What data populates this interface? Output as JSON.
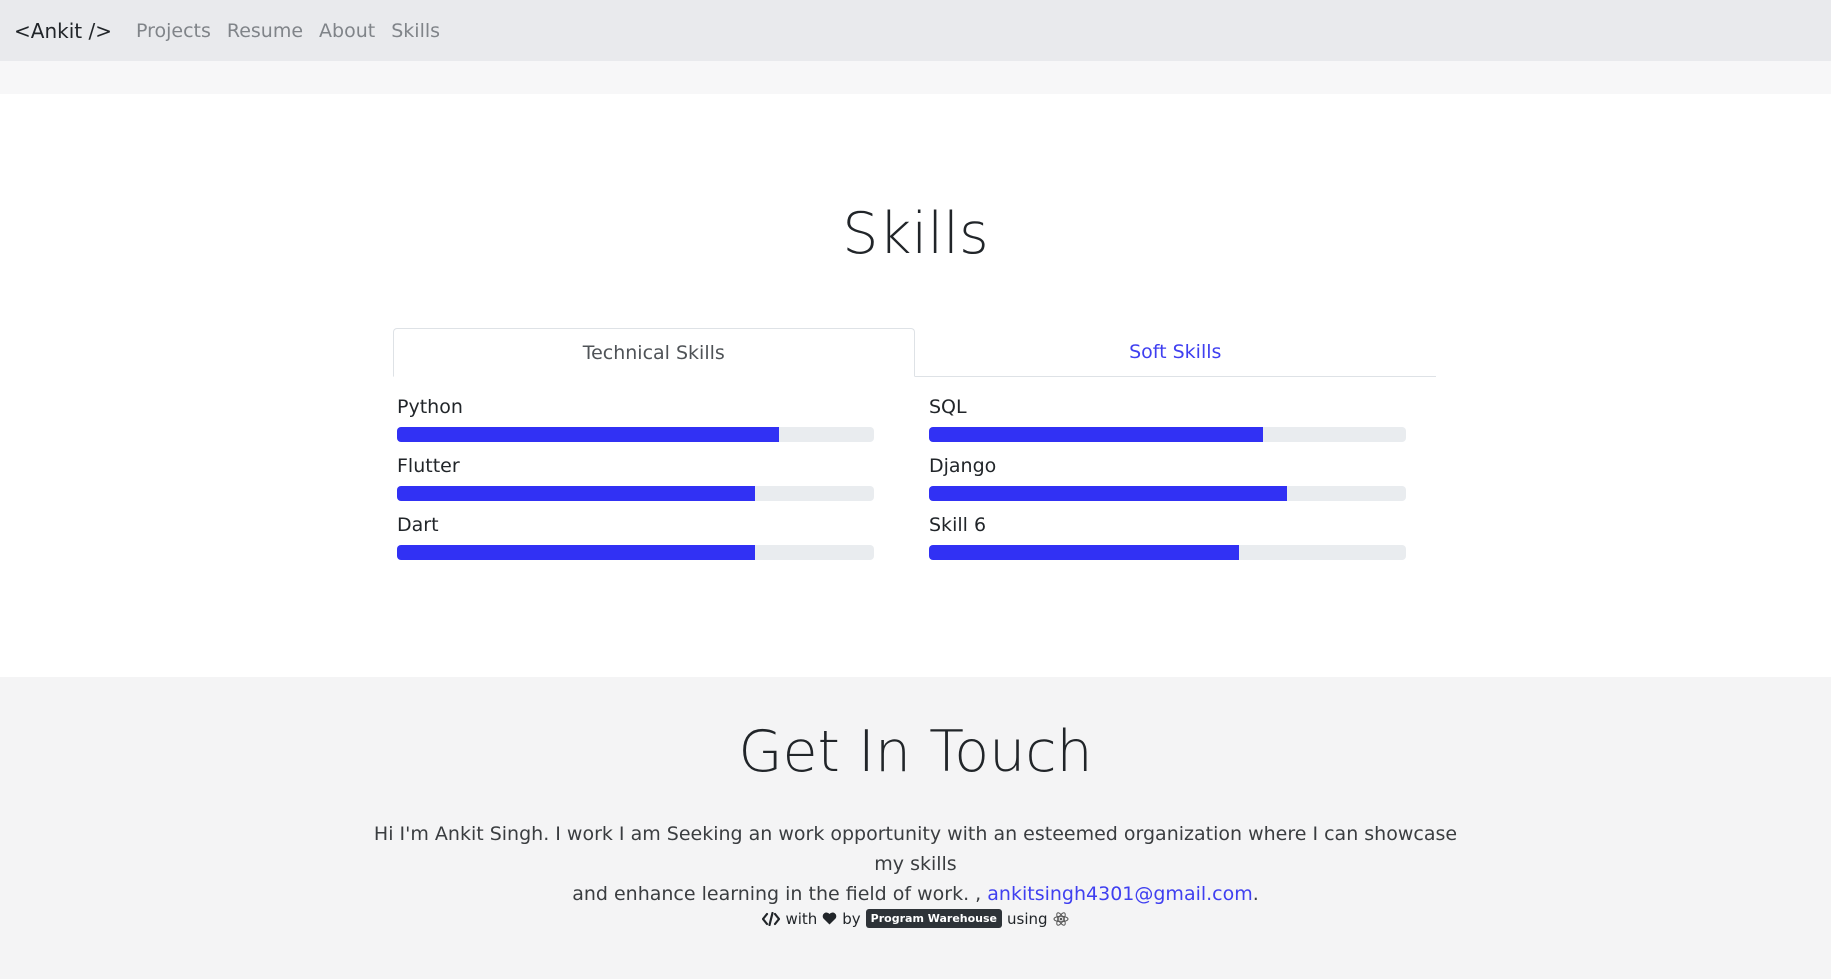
{
  "navbar": {
    "brand": "<Ankit />",
    "links": [
      "Projects",
      "Resume",
      "About",
      "Skills"
    ]
  },
  "skills": {
    "title": "Skills",
    "tabs": [
      {
        "label": "Technical Skills",
        "active": true
      },
      {
        "label": "Soft Skills",
        "active": false
      }
    ],
    "left": [
      {
        "name": "Python",
        "percent": 80
      },
      {
        "name": "Flutter",
        "percent": 75
      },
      {
        "name": "Dart",
        "percent": 75
      }
    ],
    "right": [
      {
        "name": "SQL",
        "percent": 70
      },
      {
        "name": "Django",
        "percent": 75
      },
      {
        "name": "Skill 6",
        "percent": 65
      }
    ]
  },
  "contact": {
    "title": "Get In Touch",
    "line1": "Hi I'm Ankit Singh. I work I am Seeking an work opportunity with an esteemed organization where I can showcase my skills",
    "line2_prefix": "and enhance learning in the field of work. ,",
    "email": "ankitsingh4301@gmail.com",
    "line2_suffix": "."
  },
  "footer": {
    "with": "with",
    "by": "by",
    "badge": "Program Warehouse",
    "using": "using"
  },
  "colors": {
    "accent": "#3131f4",
    "link": "#3f3ff0"
  },
  "icons": {
    "code": "code-icon",
    "heart": "heart-icon",
    "react": "react-icon"
  }
}
